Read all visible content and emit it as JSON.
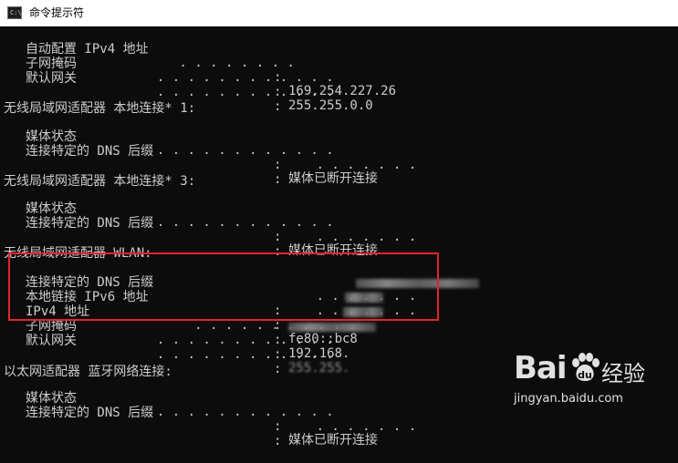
{
  "window": {
    "icon_text": "C:\\",
    "title": "命令提示符"
  },
  "lines": [
    {
      "label": "自动配置 IPv4 地址",
      "dots": " . . . . . . . .",
      "colon": ":",
      "value": "169.254.227.26"
    },
    {
      "label": "子网掩码",
      "dots": "         . . . . . . . . . . . .",
      "colon": ":",
      "value": "255.255.0.0"
    },
    {
      "label": "默认网关",
      "dots": "         . . . . . . . . . . . .",
      "colon": ":",
      "value": ""
    }
  ],
  "sections": [
    {
      "header": "无线局域网适配器 本地连接* 1:",
      "rows": [
        {
          "label": "媒体状态",
          "dots": "         . . . . . . . . . . . .",
          "colon": ":",
          "value": "媒体已断开连接"
        },
        {
          "label": "连接特定的 DNS 后缀",
          "dots": "                    . . . . . . .",
          "colon": ":",
          "value": ""
        }
      ]
    },
    {
      "header": "无线局域网适配器 本地连接* 3:",
      "rows": [
        {
          "label": "媒体状态",
          "dots": "         . . . . . . . . . . . .",
          "colon": ":",
          "value": "媒体已断开连接"
        },
        {
          "label": "连接特定的 DNS 后缀",
          "dots": "                    . . . . . . .",
          "colon": ":",
          "value": ""
        }
      ]
    },
    {
      "header": "无线局域网适配器 WLAN:",
      "rows": [
        {
          "label": "连接特定的 DNS 后缀",
          "dots": "                    . . . . . . .",
          "colon": ":",
          "value": ""
        },
        {
          "label": "本地链接 IPv6 地址",
          "dots": "                    . . . . . . .",
          "colon": ":",
          "value": "fe80::bc8"
        },
        {
          "label": "IPv4 地址",
          "dots": "            . . . . . . . . . . .",
          "colon": ":",
          "value": "192.168."
        },
        {
          "label": "子网掩码",
          "dots": "         . . . . . . . . . . . .",
          "colon": ":",
          "value": "255.255."
        },
        {
          "label": "默认网关",
          "dots": "         . . . . . . . . . . . .",
          "colon": ":",
          "value": ""
        }
      ]
    },
    {
      "header": "以太网适配器 蓝牙网络连接:",
      "rows": [
        {
          "label": "媒体状态",
          "dots": "         . . . . . . . . . . . .",
          "colon": ":",
          "value": "媒体已断开连接"
        },
        {
          "label": "连接特定的 DNS 后缀",
          "dots": "                    . . . . . . .",
          "colon": ":",
          "value": ""
        }
      ]
    }
  ],
  "watermark": {
    "brand": "Bai",
    "brand2": "经验",
    "url": "jingyan.baidu.com"
  },
  "colors": {
    "console_bg": "#0c0c0c",
    "console_text": "#cccccc",
    "highlight": "#e0262a"
  }
}
